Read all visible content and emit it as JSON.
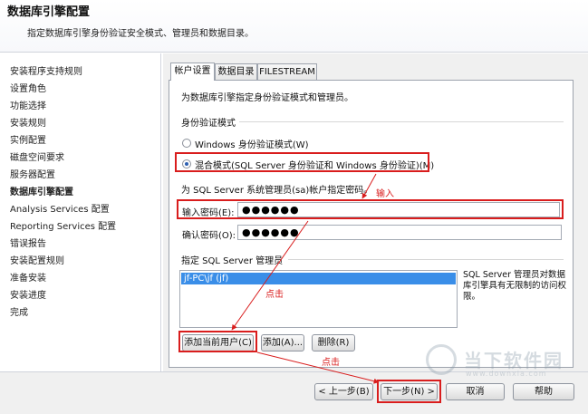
{
  "header": {
    "title": "数据库引擎配置",
    "subtitle": "指定数据库引擎身份验证安全模式、管理员和数据目录。"
  },
  "sidebar": {
    "items": [
      {
        "label": "安装程序支持规则"
      },
      {
        "label": "设置角色"
      },
      {
        "label": "功能选择"
      },
      {
        "label": "安装规则"
      },
      {
        "label": "实例配置"
      },
      {
        "label": "磁盘空间要求"
      },
      {
        "label": "服务器配置"
      },
      {
        "label": "数据库引擎配置",
        "current": true
      },
      {
        "label": "Analysis Services 配置"
      },
      {
        "label": "Reporting Services 配置"
      },
      {
        "label": "错误报告"
      },
      {
        "label": "安装配置规则"
      },
      {
        "label": "准备安装"
      },
      {
        "label": "安装进度"
      },
      {
        "label": "完成"
      }
    ]
  },
  "tabs": [
    {
      "label": "帐户设置",
      "active": true
    },
    {
      "label": "数据目录"
    },
    {
      "label": "FILESTREAM"
    }
  ],
  "account": {
    "description": "为数据库引擎指定身份验证模式和管理员。",
    "auth_group": "身份验证模式",
    "windows_mode": "Windows 身份验证模式(W)",
    "mixed_mode": "混合模式(SQL Server 身份验证和 Windows 身份验证)(M)",
    "sa_prompt": "为 SQL Server 系统管理员(sa)帐户指定密码。",
    "enter_password_label": "输入密码(E):",
    "enter_password_value": "●●●●●●",
    "confirm_password_label": "确认密码(O):",
    "confirm_password_value": "●●●●●●",
    "admins_group": "指定 SQL Server 管理员",
    "admins_list": [
      "jf-PC\\jf (jf)"
    ],
    "admins_info": "SQL Server 管理员对数据库引擎具有无限制的访问权限。",
    "add_current_user": "添加当前用户(C)",
    "add": "添加(A)...",
    "remove": "删除(R)"
  },
  "footer": {
    "back": "< 上一步(B)",
    "next": "下一步(N) >",
    "cancel": "取消",
    "help": "帮助"
  },
  "annotations": {
    "input_note": "输入",
    "click_note_1": "点击",
    "click_note_2": "点击"
  },
  "watermark": {
    "brand": "当下软件园",
    "url": "www.downxia.com"
  },
  "colors": {
    "highlight_red": "#d91d1d",
    "selection_blue": "#3a8ee8"
  }
}
